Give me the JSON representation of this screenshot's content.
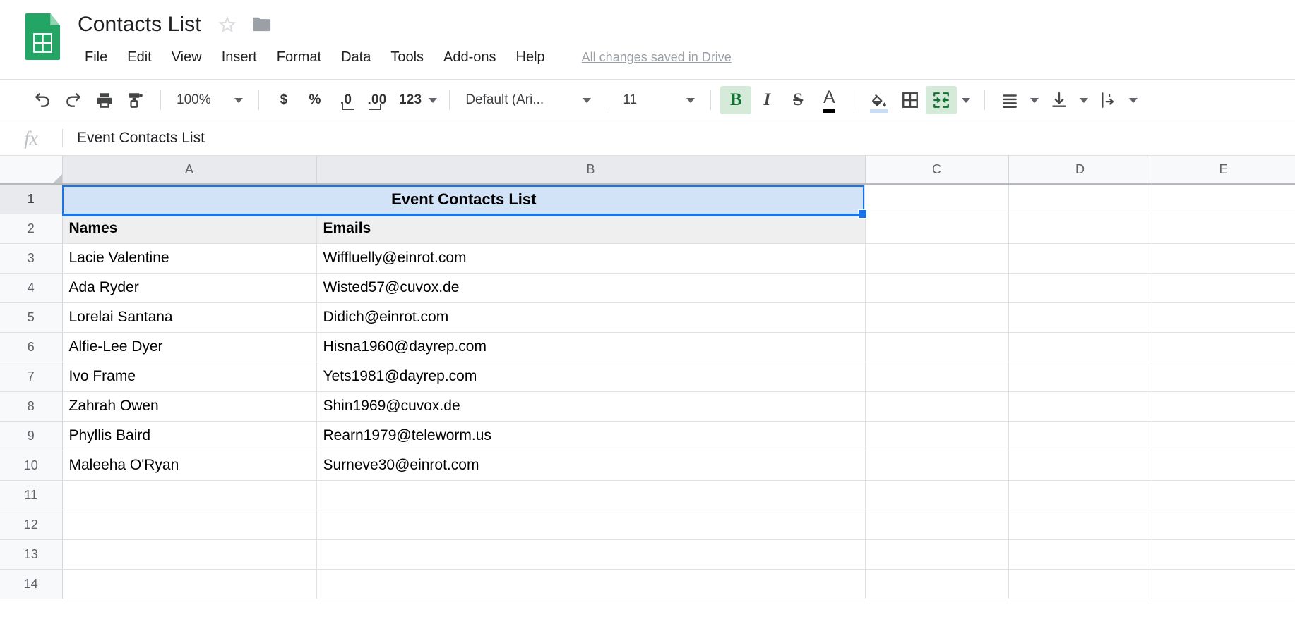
{
  "app": {
    "logo_icon": "google-sheets-icon",
    "doc_title": "Contacts List",
    "star_icon": "star-outline-icon",
    "folder_icon": "folder-icon",
    "save_status": "All changes saved in Drive"
  },
  "menu": {
    "items": [
      {
        "label": "File",
        "name": "menu-file"
      },
      {
        "label": "Edit",
        "name": "menu-edit"
      },
      {
        "label": "View",
        "name": "menu-view"
      },
      {
        "label": "Insert",
        "name": "menu-insert"
      },
      {
        "label": "Format",
        "name": "menu-format"
      },
      {
        "label": "Data",
        "name": "menu-data"
      },
      {
        "label": "Tools",
        "name": "menu-tools"
      },
      {
        "label": "Add-ons",
        "name": "menu-add-ons"
      },
      {
        "label": "Help",
        "name": "menu-help"
      }
    ]
  },
  "toolbar": {
    "undo_icon": "undo-icon",
    "redo_icon": "redo-icon",
    "print_icon": "print-icon",
    "paint_format_icon": "paint-format-icon",
    "zoom_value": "100%",
    "currency_label": "$",
    "percent_label": "%",
    "decrease_decimal_label": ".0",
    "increase_decimal_label": ".00",
    "number_format_label": "123",
    "font_value": "Default (Ari...",
    "font_size_value": "11",
    "bold_label": "B",
    "italic_label": "I",
    "strikethrough_label": "S",
    "text_color_label": "A",
    "fill_color_icon": "fill-color-icon",
    "borders_icon": "borders-icon",
    "merge_cells_icon": "merge-cells-icon",
    "horizontal_align_icon": "horizontal-align-icon",
    "vertical_align_icon": "vertical-align-icon",
    "text_wrap_icon": "text-wrapping-icon",
    "accent_green": "#137333",
    "accent_green_bg": "#d5ead9",
    "bold_active": "true",
    "merge_active": "true"
  },
  "formula_bar": {
    "fx_label": "fx",
    "value": "Event Contacts List"
  },
  "sheet": {
    "columns": [
      "A",
      "B",
      "C",
      "D",
      "E"
    ],
    "selected_column_indices": [
      0,
      1
    ],
    "rows": [
      "1",
      "2",
      "3",
      "4",
      "5",
      "6",
      "7",
      "8",
      "9",
      "10",
      "11",
      "12",
      "13",
      "14"
    ],
    "selected_row_indices": [
      0
    ],
    "selection_range": "A1:B1",
    "selection_border_color": "#1a73e8",
    "selection_fill_color": "#d2e3f8",
    "header_fill_color": "#efefef",
    "title_cell": {
      "text": "Event Contacts List",
      "merged": "A1:B1",
      "bold": "true",
      "align": "center"
    },
    "table_headers": [
      "Names",
      "Emails"
    ],
    "contacts": [
      {
        "name": "Lacie Valentine",
        "email": "Wiffluelly@einrot.com"
      },
      {
        "name": "Ada Ryder",
        "email": "Wisted57@cuvox.de"
      },
      {
        "name": "Lorelai Santana",
        "email": "Didich@einrot.com"
      },
      {
        "name": "Alfie-Lee Dyer",
        "email": "Hisna1960@dayrep.com"
      },
      {
        "name": "Ivo Frame",
        "email": "Yets1981@dayrep.com"
      },
      {
        "name": "Zahrah Owen",
        "email": "Shin1969@cuvox.de"
      },
      {
        "name": "Phyllis Baird",
        "email": "Rearn1979@teleworm.us"
      },
      {
        "name": "Maleeha O'Ryan",
        "email": "Surneve30@einrot.com"
      }
    ]
  }
}
